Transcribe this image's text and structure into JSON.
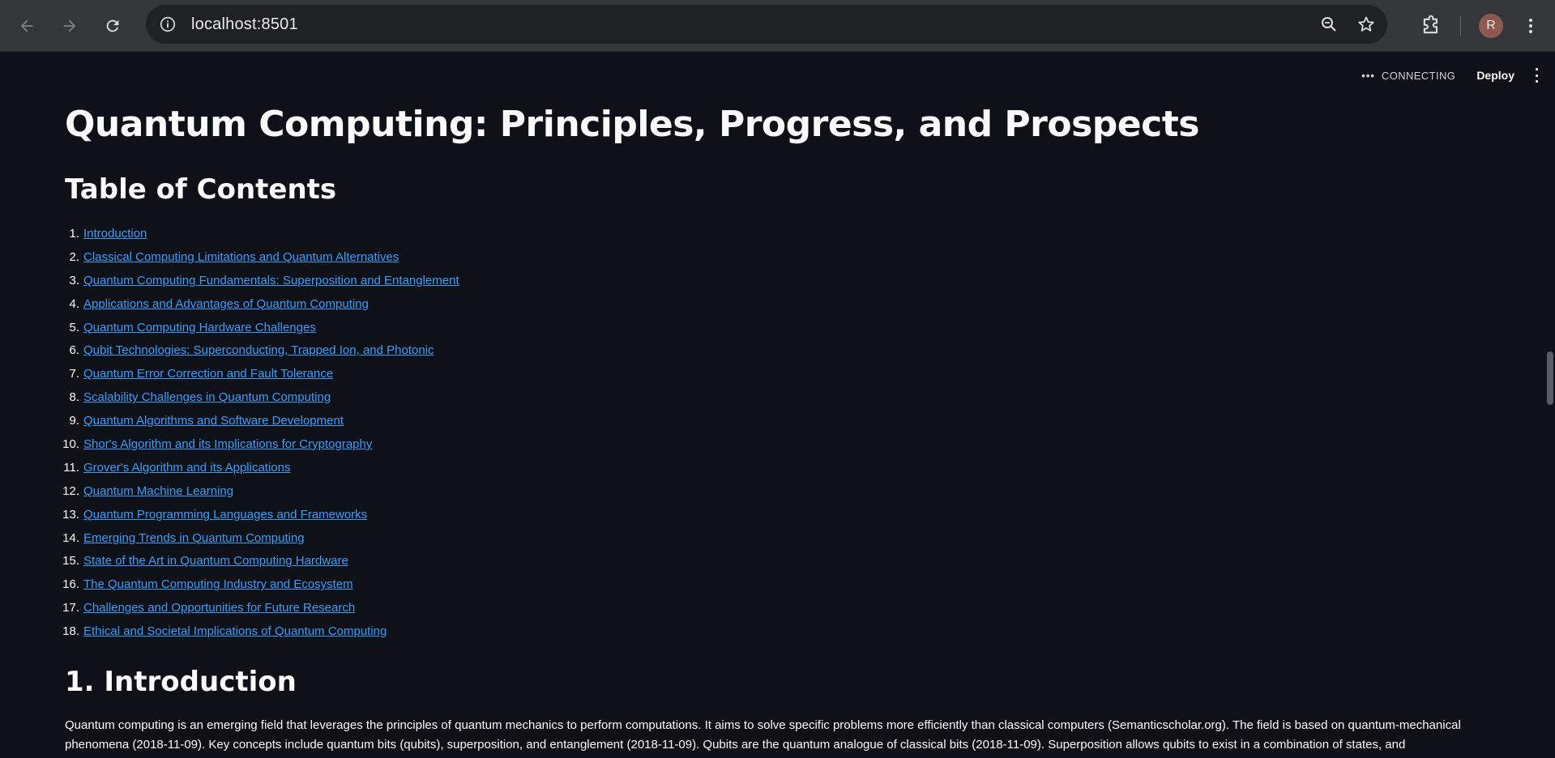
{
  "browser": {
    "url": "localhost:8501",
    "avatar_initial": "R"
  },
  "toolbar": {
    "status_dots": "•••",
    "status": "CONNECTING",
    "deploy": "Deploy"
  },
  "page": {
    "title": "Quantum Computing: Principles, Progress, and Prospects",
    "toc_heading": "Table of Contents",
    "toc": [
      {
        "num": "1.",
        "label": "Introduction"
      },
      {
        "num": "2.",
        "label": "Classical Computing Limitations and Quantum Alternatives"
      },
      {
        "num": "3.",
        "label": "Quantum Computing Fundamentals: Superposition and Entanglement"
      },
      {
        "num": "4.",
        "label": "Applications and Advantages of Quantum Computing"
      },
      {
        "num": "5.",
        "label": "Quantum Computing Hardware Challenges"
      },
      {
        "num": "6.",
        "label": "Qubit Technologies: Superconducting, Trapped Ion, and Photonic"
      },
      {
        "num": "7.",
        "label": "Quantum Error Correction and Fault Tolerance"
      },
      {
        "num": "8.",
        "label": "Scalability Challenges in Quantum Computing"
      },
      {
        "num": "9.",
        "label": "Quantum Algorithms and Software Development"
      },
      {
        "num": "10.",
        "label": "Shor's Algorithm and its Implications for Cryptography"
      },
      {
        "num": "11.",
        "label": "Grover's Algorithm and its Applications"
      },
      {
        "num": "12.",
        "label": "Quantum Machine Learning"
      },
      {
        "num": "13.",
        "label": "Quantum Programming Languages and Frameworks"
      },
      {
        "num": "14.",
        "label": "Emerging Trends in Quantum Computing"
      },
      {
        "num": "15.",
        "label": "State of the Art in Quantum Computing Hardware"
      },
      {
        "num": "16.",
        "label": "The Quantum Computing Industry and Ecosystem"
      },
      {
        "num": "17.",
        "label": "Challenges and Opportunities for Future Research"
      },
      {
        "num": "18.",
        "label": "Ethical and Societal Implications of Quantum Computing"
      }
    ],
    "intro_heading": "1. Introduction",
    "intro_text": "Quantum computing is an emerging field that leverages the principles of quantum mechanics to perform computations. It aims to solve specific problems more efficiently than classical computers (Semanticscholar.org). The field is based on quantum-mechanical phenomena (2018-11-09). Key concepts include quantum bits (qubits), superposition, and entanglement (2018-11-09). Qubits are the quantum analogue of classical bits (2018-11-09). Superposition allows qubits to exist in a combination of states, and"
  }
}
